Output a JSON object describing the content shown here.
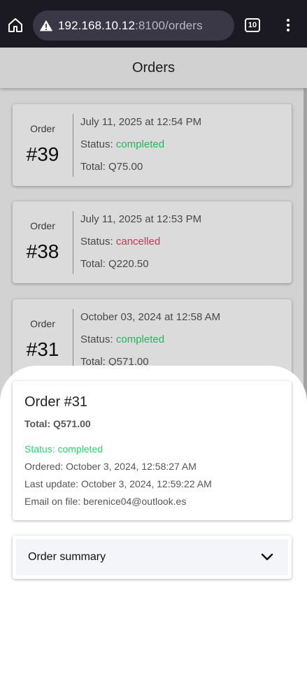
{
  "browser": {
    "url_host": "192.168.10.12",
    "url_path": ":8100/orders",
    "tab_count": "10"
  },
  "header": {
    "title": "Orders"
  },
  "orders": [
    {
      "label": "Order",
      "number": "#39",
      "date": "July 11, 2025 at 12:54 PM",
      "status_label": "Status: ",
      "status": "completed",
      "total": "Total: Q75.00"
    },
    {
      "label": "Order",
      "number": "#38",
      "date": "July 11, 2025 at 12:53 PM",
      "status_label": "Status: ",
      "status": "cancelled",
      "total": "Total: Q220.50"
    },
    {
      "label": "Order",
      "number": "#31",
      "date": "October 03, 2024 at 12:58 AM",
      "status_label": "Status: ",
      "status": "completed",
      "total": "Total: Q571.00"
    }
  ],
  "detail": {
    "title": "Order #31",
    "total": "Total: Q571.00",
    "status": "Status: completed",
    "ordered": "Ordered: October 3, 2024, 12:58:27 AM",
    "last_update": "Last update: October 3, 2024, 12:59:22 AM",
    "email": "Email on file: berenice04@outlook.es"
  },
  "summary": {
    "label": "Order summary"
  },
  "colors": {
    "completed": "#2dd36f",
    "cancelled": "#eb445a"
  }
}
